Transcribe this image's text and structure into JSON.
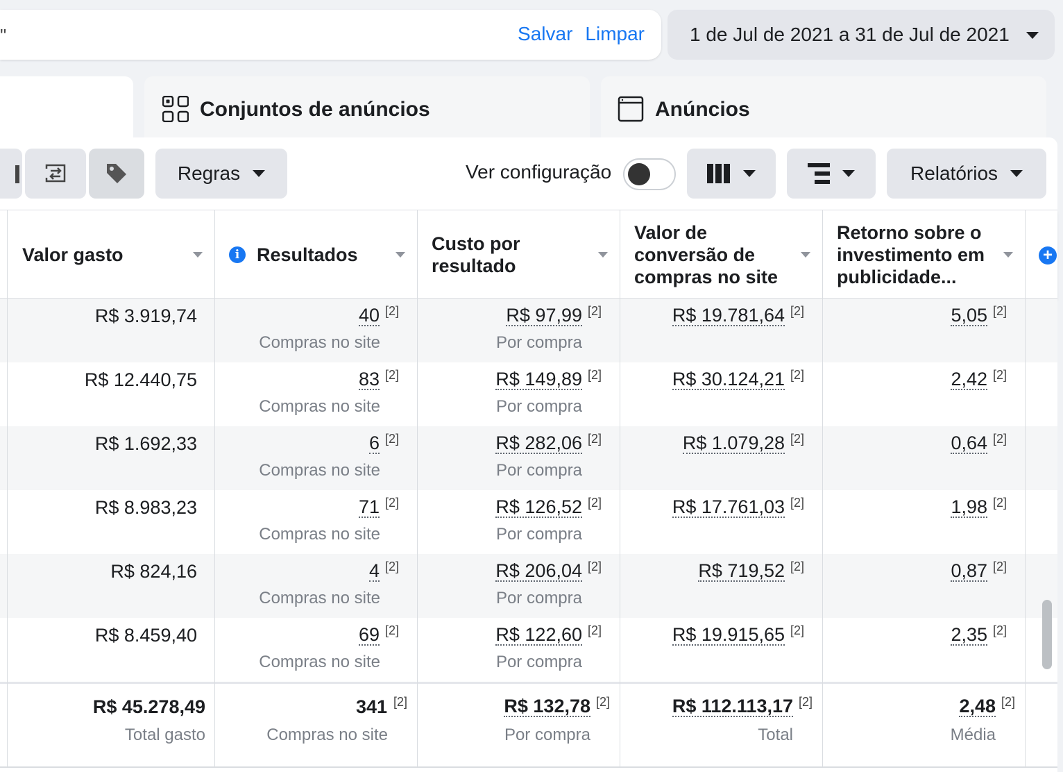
{
  "search": {
    "query_fragment": "\"",
    "save_label": "Salvar",
    "clear_label": "Limpar"
  },
  "date_range": {
    "label": "1 de Jul de 2021 a 31 de Jul de 2021"
  },
  "tabs": [
    {
      "label": "Conjuntos de anúncios",
      "icon": "grid-icon"
    },
    {
      "label": "Anúncios",
      "icon": "ad-window-icon"
    }
  ],
  "toolbar": {
    "rules_label": "Regras",
    "view_config_label": "Ver configuração",
    "view_config_on": false,
    "reports_label": "Relatórios"
  },
  "columns": [
    {
      "label": "Valor gasto"
    },
    {
      "label": "Resultados"
    },
    {
      "label": "Custo por resultado"
    },
    {
      "label": "Valor de conversão de compras no site"
    },
    {
      "label": "Retorno sobre o investimento em publicidade..."
    }
  ],
  "rows": [
    {
      "spend": "R$ 3.919,74",
      "results": "40",
      "results_type": "Compras no site",
      "cpr": "R$ 97,99",
      "cpr_type": "Por compra",
      "conv_value": "R$ 19.781,64",
      "roas": "5,05"
    },
    {
      "spend": "R$ 12.440,75",
      "results": "83",
      "results_type": "Compras no site",
      "cpr": "R$ 149,89",
      "cpr_type": "Por compra",
      "conv_value": "R$ 30.124,21",
      "roas": "2,42"
    },
    {
      "spend": "R$ 1.692,33",
      "results": "6",
      "results_type": "Compras no site",
      "cpr": "R$ 282,06",
      "cpr_type": "Por compra",
      "conv_value": "R$ 1.079,28",
      "roas": "0,64"
    },
    {
      "spend": "R$ 8.983,23",
      "results": "71",
      "results_type": "Compras no site",
      "cpr": "R$ 126,52",
      "cpr_type": "Por compra",
      "conv_value": "R$ 17.761,03",
      "roas": "1,98"
    },
    {
      "spend": "R$ 824,16",
      "results": "4",
      "results_type": "Compras no site",
      "cpr": "R$ 206,04",
      "cpr_type": "Por compra",
      "conv_value": "R$ 719,52",
      "roas": "0,87"
    },
    {
      "spend": "R$ 8.459,40",
      "results": "69",
      "results_type": "Compras no site",
      "cpr": "R$ 122,60",
      "cpr_type": "Por compra",
      "conv_value": "R$ 19.915,65",
      "roas": "2,35"
    }
  ],
  "footnote": "[2]",
  "totals": {
    "spend": "R$ 45.278,49",
    "spend_label": "Total gasto",
    "results": "341",
    "results_label": "Compras no site",
    "cpr": "R$ 132,78",
    "cpr_label": "Por compra",
    "conv_value": "R$ 112.113,17",
    "conv_label": "Total",
    "roas": "2,48",
    "roas_label": "Média"
  },
  "colors": {
    "accent": "#1877f2",
    "alt_row": "#f5f6f7",
    "button_bg": "#e4e6eb"
  }
}
